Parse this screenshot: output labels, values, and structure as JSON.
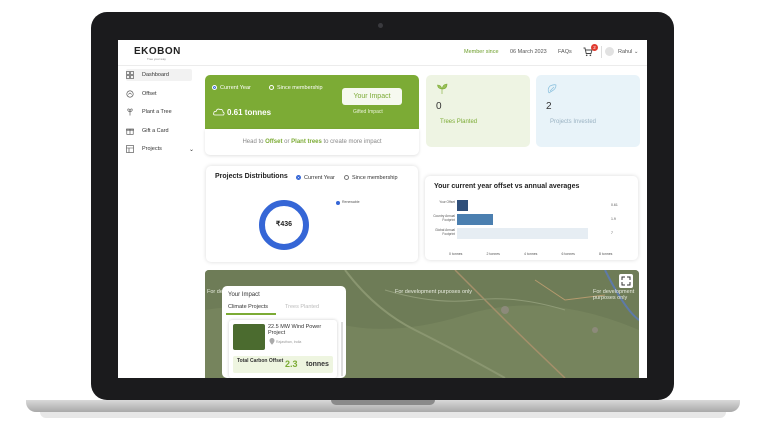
{
  "header": {
    "logo_text": "EKOBON",
    "logo_tagline": "Tree your way",
    "member_since_label": "Member since",
    "member_since_date": "06 March 2023",
    "faqs": "FAQs",
    "cart_count": "2",
    "user_name": "Rahul"
  },
  "sidebar": {
    "items": [
      {
        "label": "Dashboard"
      },
      {
        "label": "Offset"
      },
      {
        "label": "Plant a Tree"
      },
      {
        "label": "Gift a Card"
      },
      {
        "label": "Projects"
      }
    ]
  },
  "impact_card": {
    "radio_current": "Current Year",
    "radio_since": "Since membership",
    "button": "Your Impact",
    "tonnes": "0.61 tonnes",
    "gifted": "Gifted Impact",
    "head_prefix": "Head to ",
    "offset_link": "Offset",
    "or": " or ",
    "trees_link": "Plant trees",
    "head_suffix": " to create more impact"
  },
  "stats": {
    "trees_value": "0",
    "trees_label": "Trees Planted",
    "projects_value": "2",
    "projects_label": "Projects Invested"
  },
  "distribution": {
    "title": "Projects Distributions",
    "radio_current": "Current Year",
    "radio_since": "Since membership",
    "total": "₹436",
    "legend": "Renewable"
  },
  "chart_data": {
    "type": "bar",
    "title": "Your current year offset vs annual averages",
    "categories": [
      "Your Offset",
      "Country Annual Footprint",
      "Global Annual Footprint"
    ],
    "values": [
      0.61,
      1.9,
      7
    ],
    "value_labels": [
      "0.61",
      "1.9",
      "7"
    ],
    "colors": [
      "#2f4f7a",
      "#4b7fb0",
      "#e6edf3"
    ],
    "xticks": [
      "0 tonnes",
      "2 tonnes",
      "4 tonnes",
      "6 tonnes",
      "8 tonnes"
    ],
    "xlim": [
      0,
      8
    ]
  },
  "map": {
    "dev_text": "For development purposes only",
    "panel_title": "Your Impact",
    "tab_climate": "Climate Projects",
    "tab_trees": "Trees Planted",
    "project_name": "22.5 MW Wind Power Project",
    "project_location": "Rajasthan, India",
    "offset_label": "Total Carbon Offset",
    "offset_value": "2.3",
    "offset_unit": "tonnes"
  },
  "colors": {
    "brand_green": "#7cab35",
    "accent_blue": "#3566d6",
    "trees_card_bg": "#eef4e3",
    "projects_card_bg": "#e8f3f9"
  }
}
